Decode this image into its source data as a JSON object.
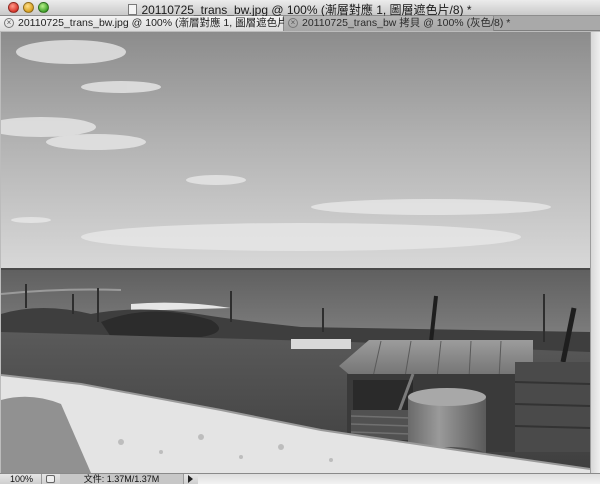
{
  "window": {
    "title": "20110725_trans_bw.jpg @ 100% (漸層對應 1, 圖層遮色片/8) *"
  },
  "tabs": [
    {
      "label": "20110725_trans_bw.jpg @ 100% (漸層對應 1, 圖層遮色片/8) *",
      "active": true
    },
    {
      "label": "20110725_trans_bw 拷貝 @ 100% (灰色/8) *",
      "active": false
    }
  ],
  "canvas": {
    "content": "grayscale seaside photo"
  },
  "status": {
    "zoom": "100%",
    "doc_size": "文件: 1.37M/1.37M"
  },
  "colors": {
    "titlebar": "#d6d6d6",
    "tab_active": "#e6e6e6",
    "tab_inactive": "#ababab",
    "statusbar": "#d8d8d8"
  }
}
